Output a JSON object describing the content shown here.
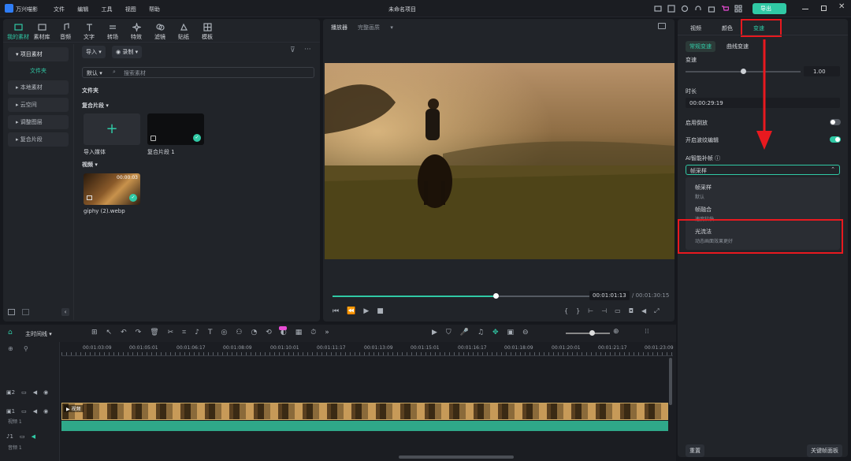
{
  "app": {
    "name": "万兴喵影",
    "project_title": "未命名项目",
    "export_label": "导出"
  },
  "menu": [
    "文件",
    "编辑",
    "工具",
    "视图",
    "帮助"
  ],
  "toolbar_tabs": [
    {
      "label": "我的素材",
      "icon": "media-icon"
    },
    {
      "label": "素材库",
      "icon": "library-icon"
    },
    {
      "label": "音频",
      "icon": "music-icon"
    },
    {
      "label": "文字",
      "icon": "text-icon"
    },
    {
      "label": "转场",
      "icon": "transition-icon"
    },
    {
      "label": "特效",
      "icon": "effects-icon"
    },
    {
      "label": "滤镜",
      "icon": "filter-icon"
    },
    {
      "label": "贴纸",
      "icon": "sticker-icon"
    },
    {
      "label": "模板",
      "icon": "template-icon"
    }
  ],
  "sidebar": {
    "items": [
      "项目素材",
      "文件夹",
      "本地素材",
      "云空间",
      "调整图层",
      "复合片段"
    ]
  },
  "media": {
    "import_label": "导入",
    "record_label": "录制",
    "sort_label": "默认",
    "search_placeholder": "搜索素材",
    "folder_label": "文件夹",
    "compound_label": "复合片段",
    "import_media_label": "导入媒体",
    "compound_clip_label": "复合片段 1",
    "video_section_label": "视频",
    "video_clip_name": "giphy (2).webp",
    "video_duration": "00:00:03"
  },
  "player": {
    "label": "播放器",
    "quality": "完整画质",
    "current_time": "00:01:01:13",
    "total_time": "/ 00:01:30:15",
    "progress": 0.63
  },
  "inspector": {
    "tabs": [
      "视频",
      "颜色",
      "变速"
    ],
    "subtabs": [
      "常规变速",
      "曲线变速"
    ],
    "speed_label": "变速",
    "speed_value": "1.00",
    "speed_fraction": 0.5,
    "duration_label": "时长",
    "duration_value": "00:00:29:19",
    "reverse_label": "启用倒放",
    "pitch_label": "开启波纹编辑",
    "ai_label": "AI智能补帧",
    "dropdown_value": "帧采样",
    "options": [
      {
        "title": "帧采样",
        "desc": "默认"
      },
      {
        "title": "帧融合",
        "desc": "速度较快"
      },
      {
        "title": "光流法",
        "desc": "动态画面效果更好"
      }
    ],
    "reset_label": "重置",
    "keyframe_label": "关键帧面板"
  },
  "timeline": {
    "label": "主时间线",
    "ticks": [
      "00:01:03:09",
      "00:01:05:01",
      "00:01:06:17",
      "00:01:08:09",
      "00:01:10:01",
      "00:01:11:17",
      "00:01:13:09",
      "00:01:15:01",
      "00:01:16:17",
      "00:01:18:09",
      "00:01:20:01",
      "00:01:21:17",
      "00:01:23:09"
    ],
    "track_video2": "2",
    "track_video1": "1",
    "track_video1_name": "视频 1",
    "track_audio1": "1",
    "track_audio1_name": "音频 1",
    "clip_label": "视频"
  },
  "colors": {
    "accent": "#30c9a5",
    "annotation": "#e8191f",
    "badge": "#e84dd4"
  }
}
